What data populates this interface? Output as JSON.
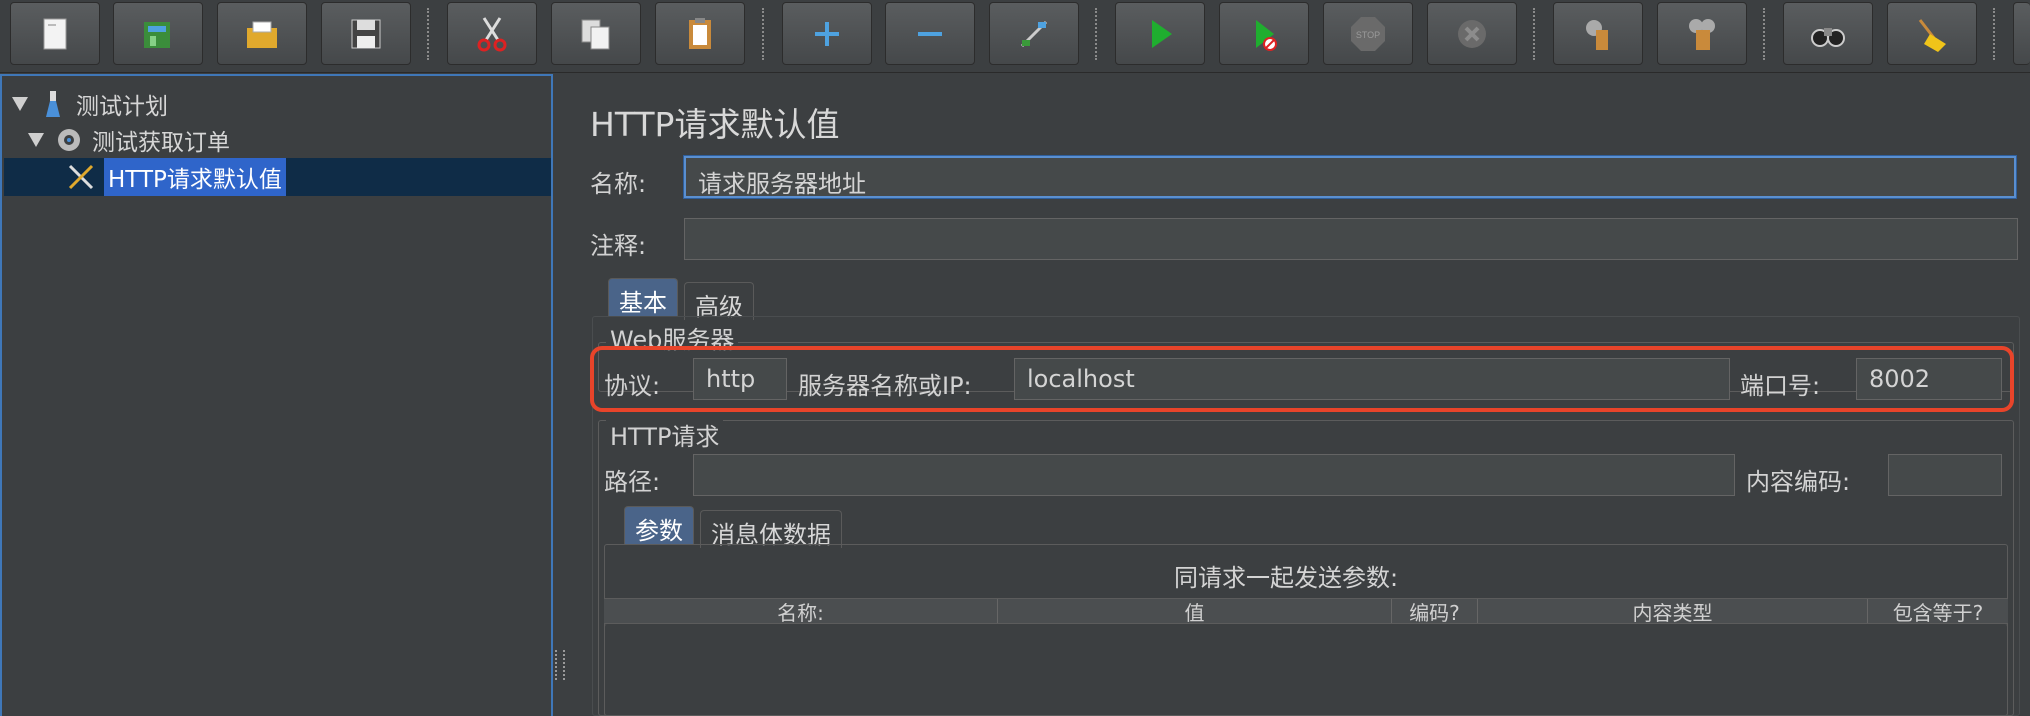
{
  "toolbar": {
    "buttons": [
      {
        "icon": "new-icon"
      },
      {
        "icon": "templates-icon"
      },
      {
        "icon": "open-icon"
      },
      {
        "icon": "save-icon"
      },
      {
        "icon": "cut-icon"
      },
      {
        "icon": "copy-icon"
      },
      {
        "icon": "paste-icon"
      },
      {
        "icon": "expand-icon"
      },
      {
        "icon": "collapse-icon"
      },
      {
        "icon": "toggle-icon"
      },
      {
        "icon": "start-icon"
      },
      {
        "icon": "start-no-pauses-icon"
      },
      {
        "icon": "stop-icon",
        "text": "STOP"
      },
      {
        "icon": "shutdown-icon"
      },
      {
        "icon": "clear-icon"
      },
      {
        "icon": "clear-all-icon"
      },
      {
        "icon": "search-icon"
      },
      {
        "icon": "reset-search-icon"
      }
    ]
  },
  "tree": {
    "items": [
      {
        "label": "测试计划",
        "icon": "test-plan-icon"
      },
      {
        "label": "测试获取订单",
        "icon": "thread-group-gear-icon"
      },
      {
        "label": "HTTP请求默认值",
        "icon": "config-wrench-icon"
      }
    ]
  },
  "panel": {
    "title": "HTTP请求默认值",
    "name_label": "名称:",
    "name_value": "请求服务器地址",
    "comment_label": "注释:",
    "comment_value": "",
    "tabs": [
      "基本",
      "高级"
    ],
    "web_server": {
      "group_title": "Web服务器",
      "protocol_label": "协议:",
      "protocol_value": "http",
      "server_label": "服务器名称或IP:",
      "server_value": "localhost",
      "port_label": "端口号:",
      "port_value": "8002"
    },
    "http_request": {
      "group_title": "HTTP请求",
      "path_label": "路径:",
      "path_value": "",
      "encoding_label": "内容编码:",
      "encoding_value": "",
      "subtabs": [
        "参数",
        "消息体数据"
      ],
      "table_title": "同请求一起发送参数:",
      "columns": [
        "名称:",
        "值",
        "编码?",
        "内容类型",
        "包含等于?"
      ]
    }
  },
  "colors": {
    "background": "#3c3f41",
    "selection": "#2f65ca",
    "highlight": "#e8442a",
    "accent_border": "#3f77b8"
  }
}
